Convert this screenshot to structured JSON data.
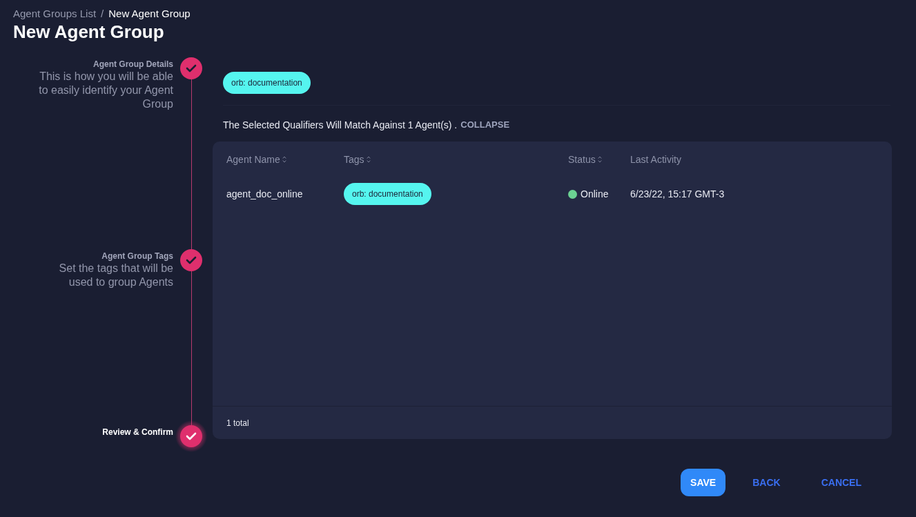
{
  "breadcrumb": [
    {
      "label": "Agent Groups List",
      "selected": false
    },
    {
      "label": "New Agent Group",
      "selected": true
    }
  ],
  "breadcrumb_separator": "/",
  "title": "New Agent Group",
  "steps": [
    {
      "title": "Agent Group Details",
      "description": "This is how you will be able to easily identify your Agent Group",
      "completed": true,
      "selected": false
    },
    {
      "title": "Agent Group Tags",
      "description": "Set the tags that will be used to group Agents",
      "completed": true,
      "selected": false
    },
    {
      "title": "Review & Confirm",
      "completed": true,
      "selected": true
    }
  ],
  "selected_tags": [
    "orb: documentation"
  ],
  "match_summary": {
    "text": "The Selected Qualifiers Will Match Against 1 Agent(s) .",
    "link": "COLLAPSE"
  },
  "table": {
    "columns": [
      {
        "label": "Agent Name",
        "sortable": true
      },
      {
        "label": "Tags",
        "sortable": true
      },
      {
        "label": "Status",
        "sortable": true
      },
      {
        "label": "Last Activity",
        "sortable": false
      }
    ],
    "rows": [
      {
        "agent_name": "agent_doc_online",
        "tags": [
          "orb: documentation"
        ],
        "status": {
          "label": "Online",
          "color": "#6bd192"
        },
        "last_activity": "6/23/22, 15:17 GMT-3"
      }
    ],
    "footer": "1 total"
  },
  "buttons": [
    {
      "label": "SAVE",
      "kind": "primary"
    },
    {
      "label": "BACK",
      "kind": "text"
    },
    {
      "label": "CANCEL",
      "kind": "text"
    }
  ]
}
